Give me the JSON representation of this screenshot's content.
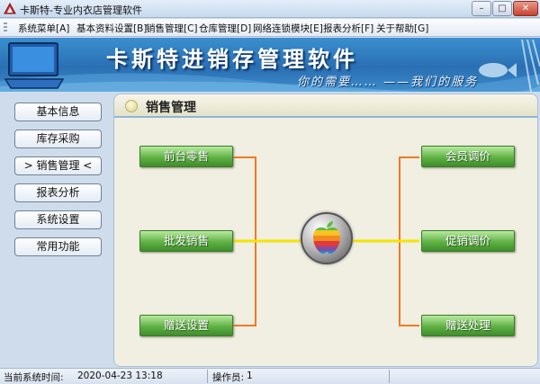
{
  "window": {
    "title": "卡斯特-专业内衣店管理软件",
    "minimize": "–",
    "maximize": "□",
    "close": "✕"
  },
  "menubar": {
    "items": [
      {
        "label": "系统菜单[A]"
      },
      {
        "label": "基本资料设置[B]"
      },
      {
        "label": "销售管理[C]"
      },
      {
        "label": "仓库管理[D]"
      },
      {
        "label": "网络连锁模块[E]"
      },
      {
        "label": "报表分析[F]"
      },
      {
        "label": "关于帮助[G]"
      }
    ]
  },
  "banner": {
    "title": "卡斯特进销存管理软件",
    "slogan": "你的需要……  ——我们的服务"
  },
  "sidebar": {
    "items": [
      {
        "label": "基本信息"
      },
      {
        "label": "库存采购"
      },
      {
        "label": "> 销售管理 <",
        "selected": true
      },
      {
        "label": "报表分析"
      },
      {
        "label": "系统设置"
      },
      {
        "label": "常用功能"
      }
    ]
  },
  "panel": {
    "title": "销售管理",
    "left_actions": [
      {
        "label": "前台零售"
      },
      {
        "label": "批发销售"
      },
      {
        "label": "赠送设置"
      }
    ],
    "right_actions": [
      {
        "label": "会员调价"
      },
      {
        "label": "促销调价"
      },
      {
        "label": "赠送处理"
      }
    ],
    "hub_icon": "apple-logo-icon"
  },
  "colors": {
    "banner": "#2f7cc0",
    "button_green": "#5fb244",
    "connector_orange": "#f07a22",
    "connector_yellow": "#f5e400"
  },
  "statusbar": {
    "time_label": "当前系统时间:",
    "time_value": "2020-04-23 13:18",
    "operator_label": "操作员:",
    "operator_value": "1"
  }
}
